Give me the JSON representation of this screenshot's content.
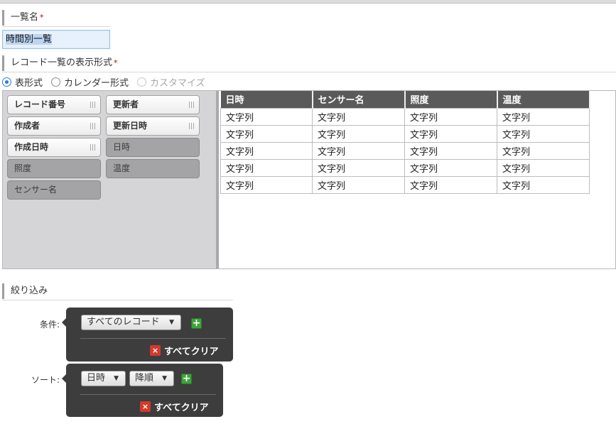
{
  "list_name": {
    "label": "一覧名",
    "required_mark": "*",
    "value": "時間別一覧"
  },
  "format": {
    "label": "レコード一覧の表示形式",
    "required_mark": "*",
    "options": [
      {
        "label": "表形式",
        "checked": true,
        "disabled": false
      },
      {
        "label": "カレンダー形式",
        "checked": false,
        "disabled": false
      },
      {
        "label": "カスタマイズ",
        "checked": false,
        "disabled": true
      }
    ]
  },
  "palette": {
    "fields": [
      {
        "label": "レコード番号",
        "used": false
      },
      {
        "label": "更新者",
        "used": false
      },
      {
        "label": "作成者",
        "used": false
      },
      {
        "label": "更新日時",
        "used": false
      },
      {
        "label": "作成日時",
        "used": false
      },
      {
        "label": "日時",
        "used": true
      },
      {
        "label": "照度",
        "used": true
      },
      {
        "label": "温度",
        "used": true
      },
      {
        "label": "センサー名",
        "used": true
      }
    ]
  },
  "grid": {
    "columns": [
      "日時",
      "センサー名",
      "照度",
      "温度"
    ],
    "rows": [
      [
        "文字列",
        "文字列",
        "文字列",
        "文字列"
      ],
      [
        "文字列",
        "文字列",
        "文字列",
        "文字列"
      ],
      [
        "文字列",
        "文字列",
        "文字列",
        "文字列"
      ],
      [
        "文字列",
        "文字列",
        "文字列",
        "文字列"
      ],
      [
        "文字列",
        "文字列",
        "文字列",
        "文字列"
      ]
    ]
  },
  "filter": {
    "label": "絞り込み",
    "condition_label": "条件:",
    "condition_value": "すべてのレコード",
    "sort_label": "ソート:",
    "sort_field": "日時",
    "sort_order": "降順",
    "clear_label": "すべてクリア",
    "add_symbol": "+",
    "clear_symbol": "×"
  },
  "colors": {
    "header_bg": "#5a5a5a",
    "add_green": "#3ea33a",
    "clear_red": "#d33a2c",
    "radio_blue": "#2a7fd4"
  }
}
